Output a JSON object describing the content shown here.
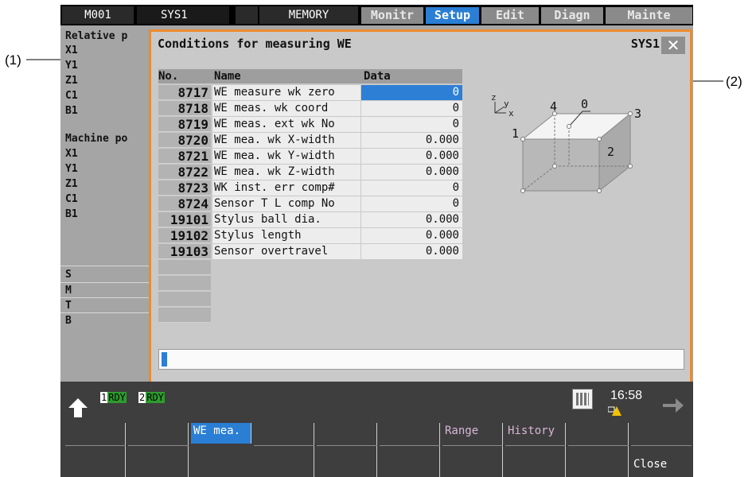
{
  "annotations": {
    "left": "(1)",
    "right": "(2)"
  },
  "topbar": {
    "program": "M001",
    "system": "SYS1",
    "mode": "MEMORY",
    "tabs": [
      {
        "label": "Monitr",
        "active": false
      },
      {
        "label": "Setup",
        "active": true
      },
      {
        "label": "Edit",
        "active": false
      },
      {
        "label": "Diagn",
        "active": false
      },
      {
        "label": "Mainte",
        "active": false
      }
    ]
  },
  "left_panel": {
    "relative_title": "Relative p",
    "relative_axes": [
      "X1",
      "Y1",
      "Z1",
      "C1",
      "B1"
    ],
    "machine_title": "Machine po",
    "machine_axes": [
      "X1",
      "Y1",
      "Z1",
      "C1",
      "B1"
    ],
    "spindle_labels": [
      "S",
      "M",
      "T",
      "B"
    ]
  },
  "dialog": {
    "title": "Conditions for measuring WE",
    "system": "SYS1",
    "close_icon": "close-icon",
    "columns": {
      "no": "No.",
      "name": "Name",
      "data": "Data"
    },
    "rows": [
      {
        "no": "8717",
        "name": "WE measure wk zero",
        "data": "0",
        "selected": true
      },
      {
        "no": "8718",
        "name": "WE meas. wk coord",
        "data": "0"
      },
      {
        "no": "8719",
        "name": "WE meas. ext wk No",
        "data": "0"
      },
      {
        "no": "8720",
        "name": "WE mea. wk X-width",
        "data": "0.000"
      },
      {
        "no": "8721",
        "name": "WE mea. wk Y-width",
        "data": "0.000"
      },
      {
        "no": "8722",
        "name": "WE mea. wk Z-width",
        "data": "0.000"
      },
      {
        "no": "8723",
        "name": "WK inst. err comp#",
        "data": "0"
      },
      {
        "no": "8724",
        "name": "Sensor T L comp No",
        "data": "0"
      },
      {
        "no": "19101",
        "name": "Stylus ball dia.",
        "data": "0.000"
      },
      {
        "no": "19102",
        "name": "Stylus length",
        "data": "0.000"
      },
      {
        "no": "19103",
        "name": "Sensor overtravel",
        "data": "0.000"
      },
      {
        "no": "",
        "name": "",
        "data": ""
      },
      {
        "no": "",
        "name": "",
        "data": ""
      },
      {
        "no": "",
        "name": "",
        "data": ""
      },
      {
        "no": "",
        "name": "",
        "data": ""
      }
    ],
    "diagram_labels": {
      "z": "z",
      "y": "y",
      "x": "x",
      "p0": "0",
      "p1": "1",
      "p2": "2",
      "p3": "3",
      "p4": "4"
    },
    "input_value": ""
  },
  "status": {
    "rdy1_num": "1",
    "rdy1": "RDY",
    "rdy2_num": "2",
    "rdy2": "RDY",
    "time": "16:58"
  },
  "softkeys": [
    "",
    "",
    "WE mea.",
    "",
    "",
    "",
    "Range",
    "History",
    "",
    "Close"
  ],
  "colors": {
    "accent": "#2a7fd4",
    "dialog_border": "#ec8b2c",
    "rdy": "#2e9b2e"
  }
}
